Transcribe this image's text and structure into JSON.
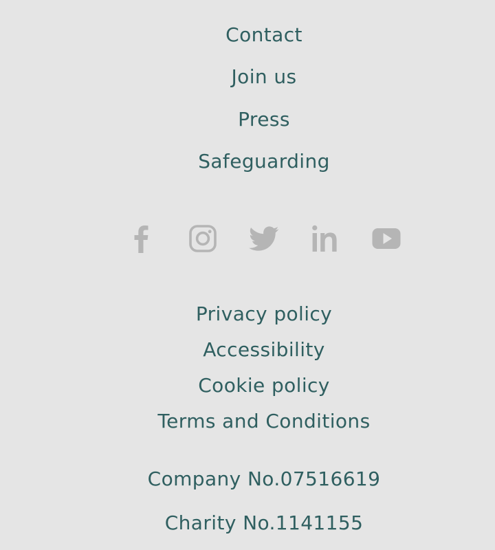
{
  "colors": {
    "background": "#e5e5e5",
    "link_text": "#2f5f60",
    "social_icon": "#b5b5b5"
  },
  "nav": {
    "items": [
      {
        "label": "Contact"
      },
      {
        "label": "Join us"
      },
      {
        "label": "Press"
      },
      {
        "label": "Safeguarding"
      }
    ]
  },
  "social": {
    "icons": [
      {
        "name": "facebook-icon"
      },
      {
        "name": "instagram-icon"
      },
      {
        "name": "twitter-icon"
      },
      {
        "name": "linkedin-icon"
      },
      {
        "name": "youtube-icon"
      }
    ]
  },
  "legal": {
    "items": [
      {
        "label": "Privacy policy"
      },
      {
        "label": "Accessibility"
      },
      {
        "label": "Cookie policy"
      },
      {
        "label": "Terms and Conditions"
      }
    ]
  },
  "registration": {
    "company": "Company No.07516619",
    "charity": "Charity No.1141155"
  }
}
